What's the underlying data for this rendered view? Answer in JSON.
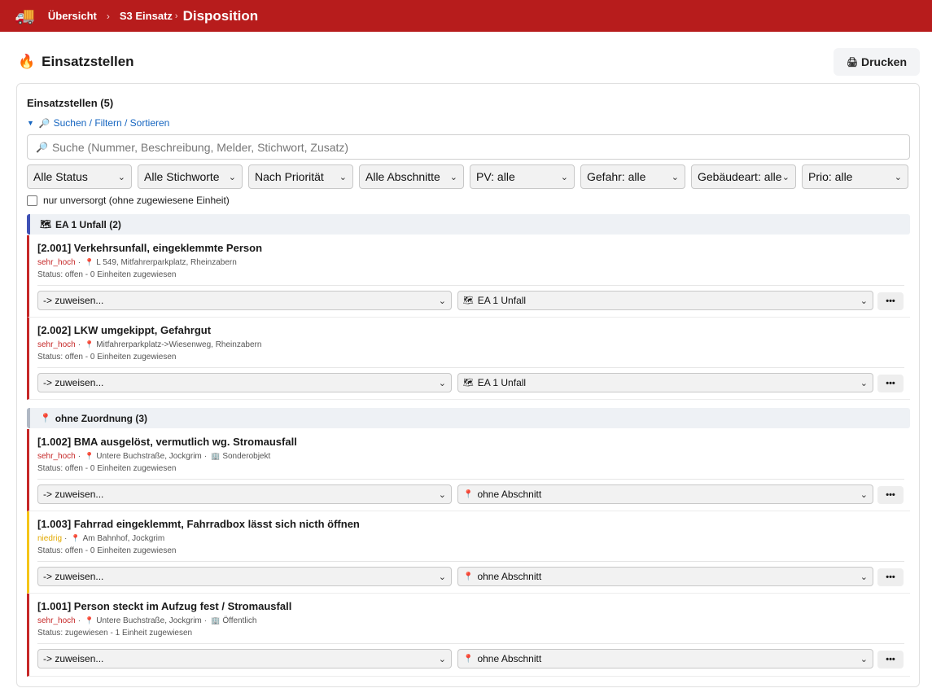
{
  "topbar": {
    "icon": "truck-icon",
    "overview": "Übersicht",
    "sep1": "›",
    "einsatz": "S3 Einsatz",
    "sep2": "›",
    "current": "Disposition"
  },
  "page": {
    "title": "Einsatzstellen",
    "title_icon": "fire-icon",
    "print_label": "Drucken",
    "print_icon": "printer-icon"
  },
  "card": {
    "title": "Einsatzstellen (5)",
    "filter_toggle": "Suchen / Filtern / Sortieren",
    "search_placeholder": "Suche (Nummer, Beschreibung, Melder, Stichwort, Zusatz)",
    "filters": [
      {
        "label": "Alle Status"
      },
      {
        "label": "Alle Stichworte"
      },
      {
        "label": "Nach Priorität"
      },
      {
        "label": "Alle Abschnitte"
      },
      {
        "label": "PV: alle"
      },
      {
        "label": "Gefahr: alle"
      },
      {
        "label": "Gebäudeart: alle"
      },
      {
        "label": "Prio: alle"
      }
    ],
    "unsupplied_label": "nur unversorgt (ohne zugewiesene Einheit)"
  },
  "groups": [
    {
      "label": "EA 1 Unfall (2)",
      "icon": "map-icon"
    },
    {
      "label": "ohne Zuordnung (3)",
      "icon": "pin-icon"
    }
  ],
  "items": [
    {
      "title": "[2.001] Verkehrsunfall, eingeklemmte Person",
      "prio": "sehr_hoch",
      "location": "L 549, Mitfahrerparkplatz, Rheinzabern",
      "building": "",
      "status": "Status: offen - 0 Einheiten zugewiesen",
      "assign": "-> zuweisen...",
      "section": "EA 1 Unfall",
      "section_icon": "map-icon",
      "more": "•••"
    },
    {
      "title": "[2.002] LKW umgekippt, Gefahrgut",
      "prio": "sehr_hoch",
      "location": "Mitfahrerparkplatz->Wiesenweg, Rheinzabern",
      "building": "",
      "status": "Status: offen - 0 Einheiten zugewiesen",
      "assign": "-> zuweisen...",
      "section": "EA 1 Unfall",
      "section_icon": "map-icon",
      "more": "•••"
    },
    {
      "title": "[1.002] BMA ausgelöst, vermutlich wg. Stromausfall",
      "prio": "sehr_hoch",
      "location": "Untere Buchstraße, Jockgrim",
      "building": "Sonderobjekt",
      "status": "Status: offen - 0 Einheiten zugewiesen",
      "assign": "-> zuweisen...",
      "section": "ohne Abschnitt",
      "section_icon": "pin-icon",
      "more": "•••"
    },
    {
      "title": "[1.003] Fahrrad eingeklemmt, Fahrradbox lässt sich nicth öffnen",
      "prio": "niedrig",
      "location": "Am Bahnhof, Jockgrim",
      "building": "",
      "status": "Status: offen - 0 Einheiten zugewiesen",
      "assign": "-> zuweisen...",
      "section": "ohne Abschnitt",
      "section_icon": "pin-icon",
      "more": "•••"
    },
    {
      "title": "[1.001] Person steckt im Aufzug fest / Stromausfall",
      "prio": "sehr_hoch",
      "location": "Untere Buchstraße, Jockgrim",
      "building": "Öffentlich",
      "status": "Status: zugewiesen - 1 Einheit zugewiesen",
      "assign": "-> zuweisen...",
      "section": "ohne Abschnitt",
      "section_icon": "pin-icon",
      "more": "•••"
    }
  ],
  "colors": {
    "topbar": "#b71c1c",
    "prio_high": "#c62828",
    "prio_low": "#f5c518",
    "link": "#1565c0"
  }
}
